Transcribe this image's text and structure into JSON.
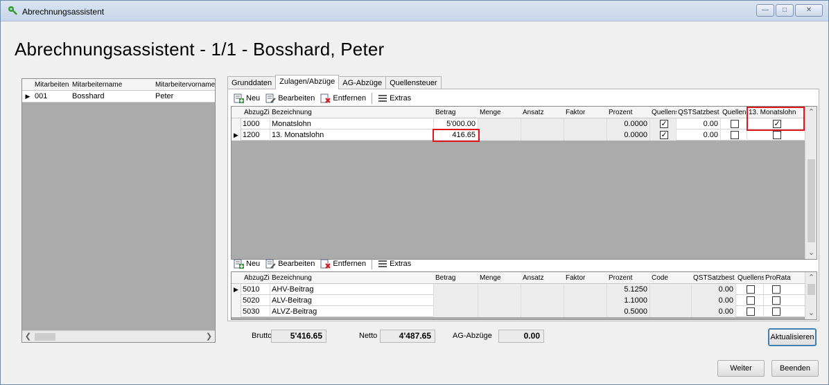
{
  "window": {
    "title": "Abrechnungsassistent",
    "minimize": "—",
    "maximize": "□",
    "close": "✕"
  },
  "heading": "Abrechnungsassistent - 1/1 - Bosshard, Peter",
  "employees": {
    "columns": [
      "Mitarbeiten",
      "Mitarbeitername",
      "Mitarbeitervorname"
    ],
    "rows": [
      {
        "nr": "001",
        "name": "Bosshard",
        "vorname": "Peter"
      }
    ]
  },
  "tabs": [
    "Grunddaten",
    "Zulagen/Abzüge",
    "AG-Abzüge",
    "Quellensteuer"
  ],
  "toolbar": {
    "new": "Neu",
    "edit": "Bearbeiten",
    "remove": "Entfernen",
    "extras": "Extras"
  },
  "zulagen": {
    "columns": [
      "AbzugZi",
      "Bezeichnung",
      "Betrag",
      "Menge",
      "Ansatz",
      "Faktor",
      "Prozent",
      "Quellens",
      "QSTSatzbest",
      "Quellens",
      "13. Monatslohn"
    ],
    "rows": [
      {
        "code": "1000",
        "bez": "Monatslohn",
        "betrag": "5'000.00",
        "prozent": "0.0000",
        "qs1": true,
        "qstsatz": "0.00",
        "qs2": false,
        "m13": true
      },
      {
        "code": "1200",
        "bez": "13. Monatslohn",
        "betrag": "416.65",
        "prozent": "0.0000",
        "qs1": true,
        "qstsatz": "0.00",
        "qs2": false,
        "m13": false
      }
    ]
  },
  "abzuege": {
    "columns": [
      "AbzugZi",
      "Bezeichnung",
      "Betrag",
      "Menge",
      "Ansatz",
      "Faktor",
      "Prozent",
      "Code",
      "QSTSatzbest",
      "Quellens",
      "ProRata"
    ],
    "rows": [
      {
        "code": "5010",
        "bez": "AHV-Beitrag",
        "prozent": "5.1250",
        "qstsatz": "0.00"
      },
      {
        "code": "5020",
        "bez": "ALV-Beitrag",
        "prozent": "1.1000",
        "qstsatz": "0.00"
      },
      {
        "code": "5030",
        "bez": "ALVZ-Beitrag",
        "prozent": "0.5000",
        "qstsatz": "0.00"
      }
    ]
  },
  "totals": {
    "brutto_label": "Brutto",
    "brutto": "5'416.65",
    "netto_label": "Netto",
    "netto": "4'487.65",
    "ag_label": "AG-Abzüge",
    "ag": "0.00"
  },
  "buttons": {
    "refresh": "Aktualisieren",
    "next": "Weiter",
    "finish": "Beenden"
  }
}
